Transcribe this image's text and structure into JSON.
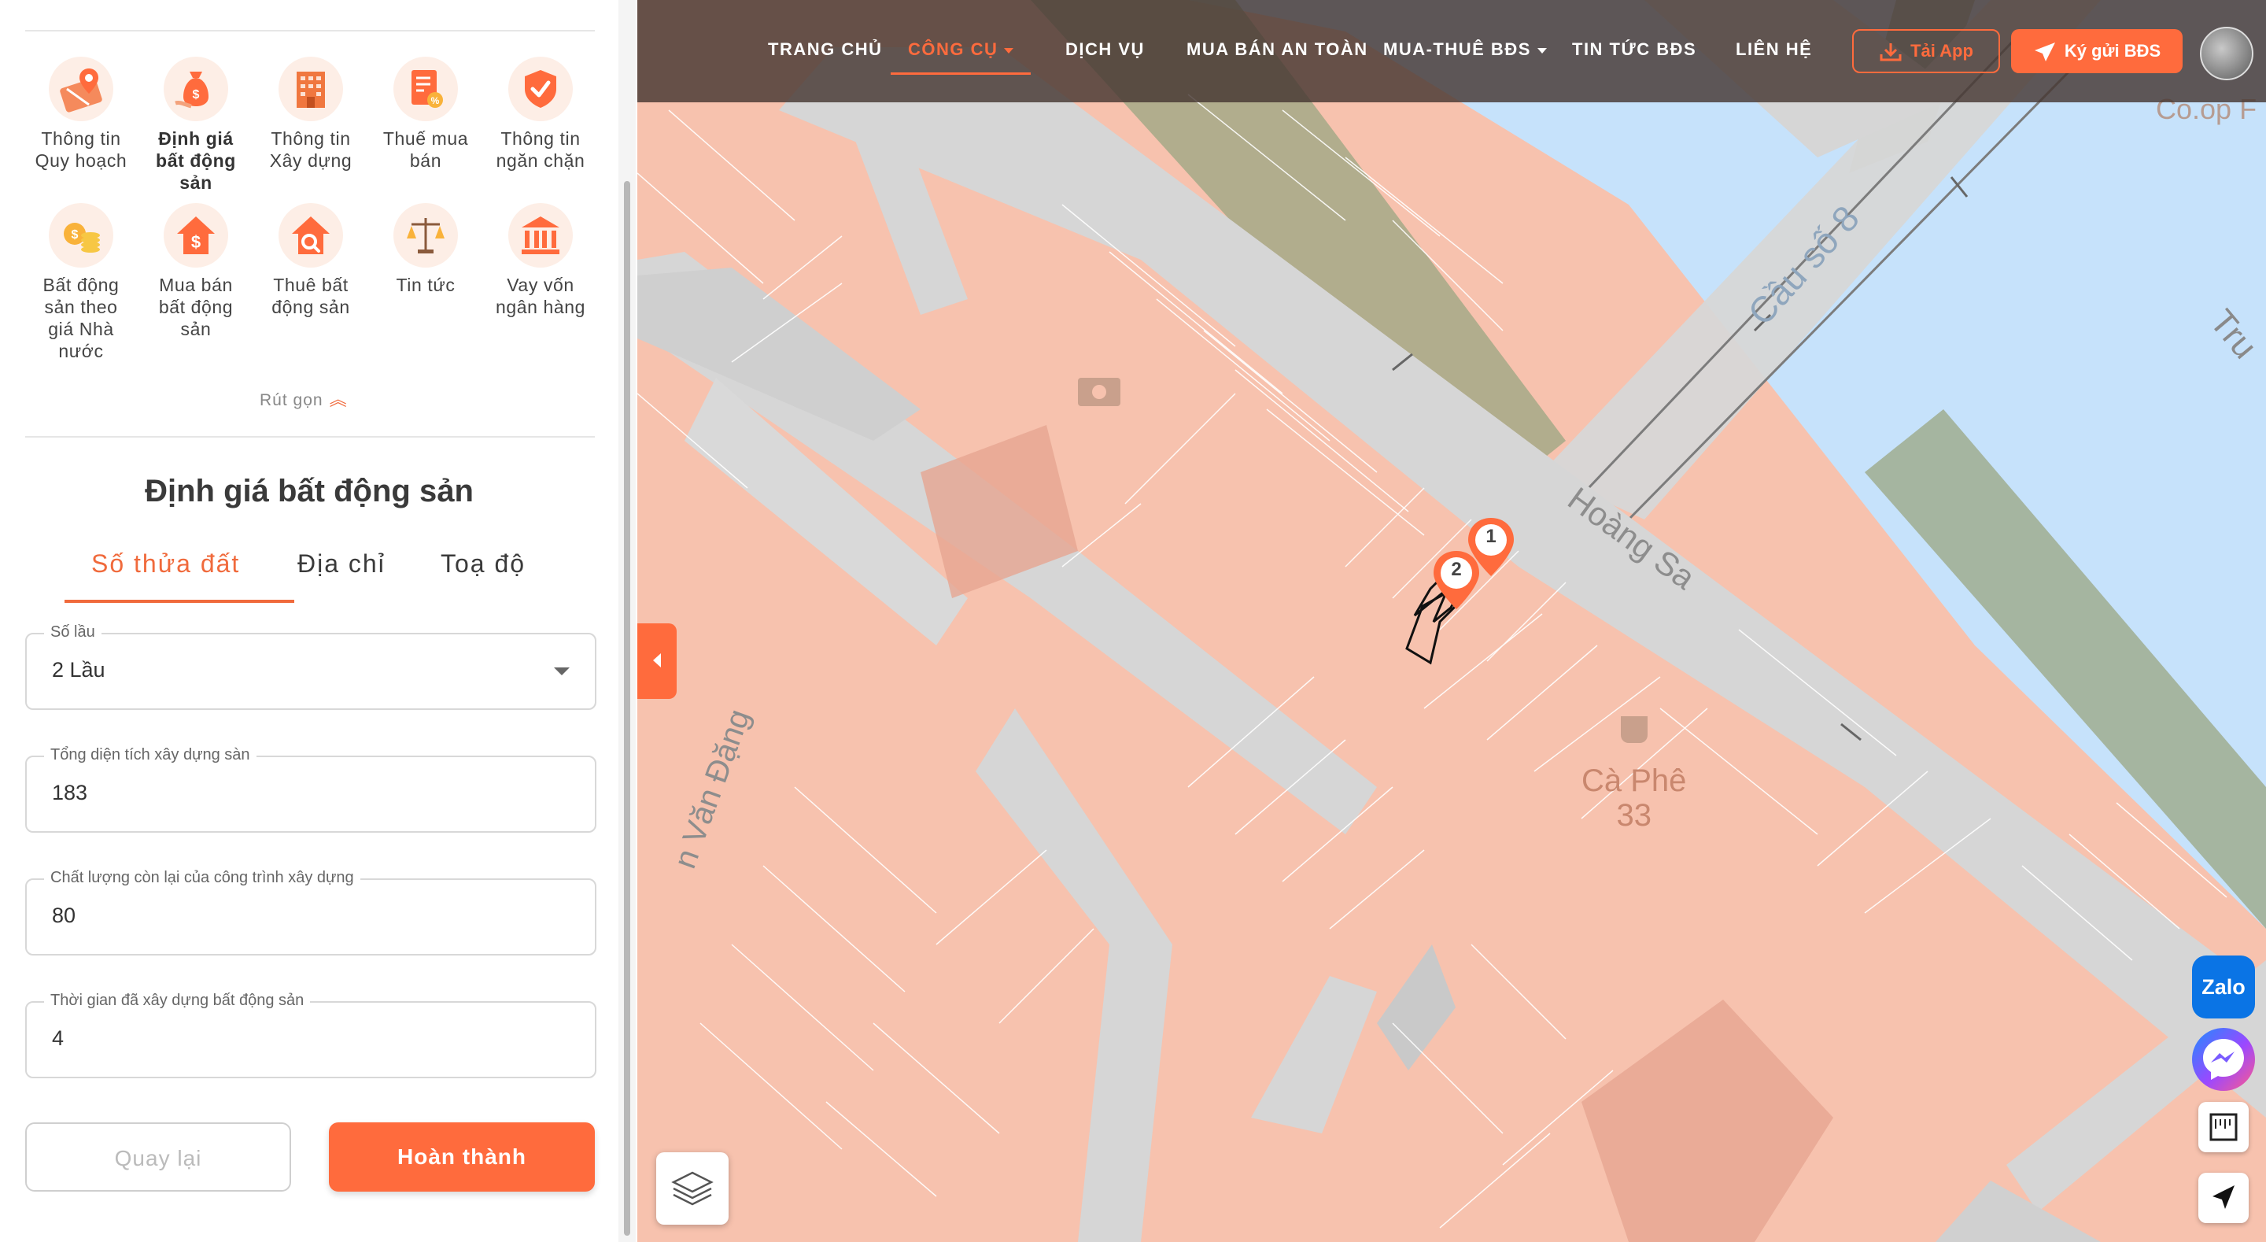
{
  "tools": [
    {
      "label": "Thông tin\nQuy hoạch",
      "icon": "planning-map-pin-icon",
      "active": false
    },
    {
      "label": "Định giá\nbất động\nsản",
      "icon": "money-bag-icon",
      "active": true
    },
    {
      "label": "Thông tin\nXây dựng",
      "icon": "building-icon",
      "active": false
    },
    {
      "label": "Thuế mua\nbán",
      "icon": "tax-document-icon",
      "active": false
    },
    {
      "label": "Thông tin\nngăn chặn",
      "icon": "shield-check-icon",
      "active": false
    },
    {
      "label": "Bất động\nsản theo\ngiá Nhà\nnước",
      "icon": "coins-icon",
      "active": false
    },
    {
      "label": "Mua bán\nbất động\nsản",
      "icon": "house-dollar-icon",
      "active": false
    },
    {
      "label": "Thuê bất\nđộng sản",
      "icon": "house-search-icon",
      "active": false
    },
    {
      "label": "Tin tức",
      "icon": "scales-icon",
      "active": false
    },
    {
      "label": "Vay vốn\nngân hàng",
      "icon": "bank-icon",
      "active": false
    }
  ],
  "collapse_label": "Rút gọn",
  "section_title": "Định giá bất động sản",
  "tabs": [
    "Số thửa đất",
    "Địa chỉ",
    "Toạ độ"
  ],
  "form": {
    "floors": {
      "label": "Số lầu",
      "value": "2 Lầu"
    },
    "total_area": {
      "label": "Tổng diện tích xây dựng sàn",
      "value": "183"
    },
    "quality": {
      "label": "Chất lượng còn lại của công trình xây dựng",
      "value": "80"
    },
    "years_built": {
      "label": "Thời gian đã xây dựng bất động sản",
      "value": "4"
    }
  },
  "buttons": {
    "back": "Quay lại",
    "done": "Hoàn thành"
  },
  "nav": {
    "items": [
      "TRANG CHỦ",
      "CÔNG CỤ",
      "DỊCH VỤ",
      "MUA BÁN AN TOÀN",
      "MUA-THUÊ BĐS",
      "TIN TỨC BĐS",
      "LIÊN HỆ"
    ],
    "active": "CÔNG CỤ",
    "app_button": "Tải App",
    "post_button": "Ký gửi BĐS"
  },
  "map": {
    "labels": {
      "bridge": "Cầu số 8",
      "street_hoang_sa": "Hoàng Sa",
      "street_van_dang": "n Văn Đặng",
      "cafe": "Cà Phê\n33",
      "coop": "Co.op F",
      "truong": "Tru"
    },
    "markers": [
      "1",
      "2"
    ]
  },
  "chat": {
    "zalo": "Zalo"
  },
  "colors": {
    "accent": "#ff6b3d",
    "parcel": "#f7c2ae",
    "water": "#c6e2fb",
    "park": "#9aa582",
    "road": "#d6d6d6"
  }
}
